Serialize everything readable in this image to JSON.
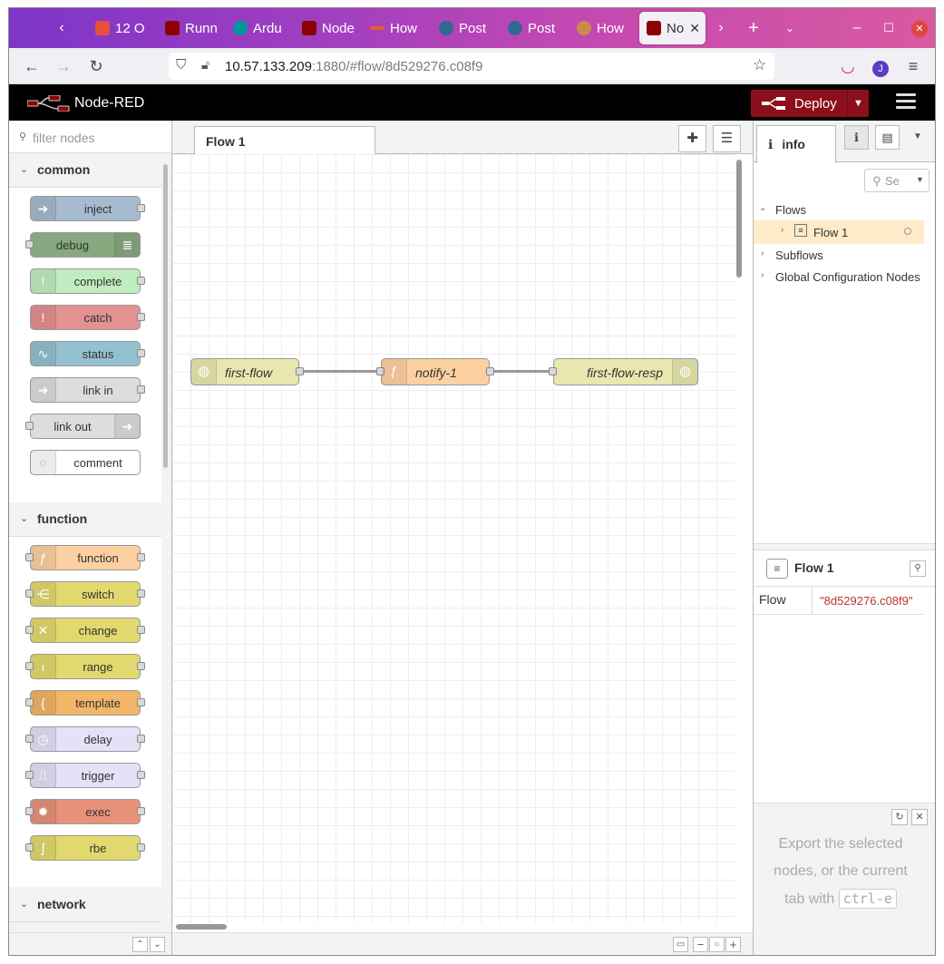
{
  "browser": {
    "tabs": [
      {
        "label": "12 O",
        "color": "#e8513a"
      },
      {
        "label": "Runn",
        "color": "#8f0000"
      },
      {
        "label": "Ardu",
        "color": "#00979d"
      },
      {
        "label": "Node",
        "color": "#8f0000"
      },
      {
        "label": "How",
        "color": "#e0632b"
      },
      {
        "label": "Post",
        "color": "#336791"
      },
      {
        "label": "Post",
        "color": "#336791"
      },
      {
        "label": "How",
        "color": "#c98a4a"
      }
    ],
    "active_tab": {
      "label": "No",
      "color": "#8f0000"
    },
    "url_host": "10.57.133.209",
    "url_rest": ":1880/#flow/8d529276.c08f9",
    "profile_initial": "J"
  },
  "app": {
    "brand": "Node-RED",
    "deploy_label": "Deploy"
  },
  "palette": {
    "search_placeholder": "filter nodes",
    "categories": [
      {
        "label": "common",
        "nodes": [
          {
            "label": "inject",
            "color": "#a6bbcf",
            "icon": "arrow-in-icon",
            "glyph": "➜"
          },
          {
            "label": "debug",
            "color": "#87a980",
            "icon": "list-icon",
            "glyph": "≣"
          },
          {
            "label": "complete",
            "color": "#c0edc0",
            "icon": "alert-icon",
            "glyph": "!"
          },
          {
            "label": "catch",
            "color": "#e49191",
            "icon": "alert-icon",
            "glyph": "!"
          },
          {
            "label": "status",
            "color": "#94c1d0",
            "icon": "pulse-icon",
            "glyph": "∿"
          },
          {
            "label": "link in",
            "color": "#dddddd",
            "icon": "link-in-icon",
            "glyph": "➜"
          },
          {
            "label": "link out",
            "color": "#dddddd",
            "icon": "link-out-icon",
            "glyph": "➜"
          },
          {
            "label": "comment",
            "color": "#ffffff",
            "icon": "comment-icon",
            "glyph": "○"
          }
        ]
      },
      {
        "label": "function",
        "nodes": [
          {
            "label": "function",
            "color": "#fdd0a2",
            "icon": "function-icon",
            "glyph": "ƒ"
          },
          {
            "label": "switch",
            "color": "#e2d96e",
            "icon": "switch-icon",
            "glyph": "⋲"
          },
          {
            "label": "change",
            "color": "#e2d96e",
            "icon": "shuffle-icon",
            "glyph": "✕"
          },
          {
            "label": "range",
            "color": "#e2d96e",
            "icon": "range-icon",
            "glyph": "ı"
          },
          {
            "label": "template",
            "color": "#f3b567",
            "icon": "template-icon",
            "glyph": "{"
          },
          {
            "label": "delay",
            "color": "#e6e0f8",
            "icon": "timer-icon",
            "glyph": "◷"
          },
          {
            "label": "trigger",
            "color": "#e6e0f8",
            "icon": "trigger-icon",
            "glyph": "⎍"
          },
          {
            "label": "exec",
            "color": "#e8927a",
            "icon": "cog-icon",
            "glyph": "✹"
          },
          {
            "label": "rbe",
            "color": "#e2d96e",
            "icon": "rbe-icon",
            "glyph": "∫"
          }
        ]
      },
      {
        "label": "network",
        "nodes": []
      }
    ]
  },
  "workspace": {
    "tab_label": "Flow 1",
    "nodes": [
      {
        "label": "first-flow",
        "color": "#e7e7ae",
        "icon": "globe-icon"
      },
      {
        "label": "notify-1",
        "color": "#fdd0a2",
        "icon": "function-icon"
      },
      {
        "label": "first-flow-resp",
        "color": "#e7e7ae",
        "icon": "globe-icon"
      }
    ]
  },
  "sidebar": {
    "tab_label": "info",
    "search_placeholder": "Se",
    "tree": {
      "flows": "Flows",
      "flow1": "Flow 1",
      "subflows": "Subflows",
      "global_config": "Global Configuration Nodes"
    },
    "props": {
      "title": "Flow 1",
      "key": "Flow",
      "value": "\"8d529276.c08f9\""
    },
    "tip": {
      "text": "Export the selected nodes, or the current tab with",
      "kbd": "ctrl-e"
    }
  }
}
